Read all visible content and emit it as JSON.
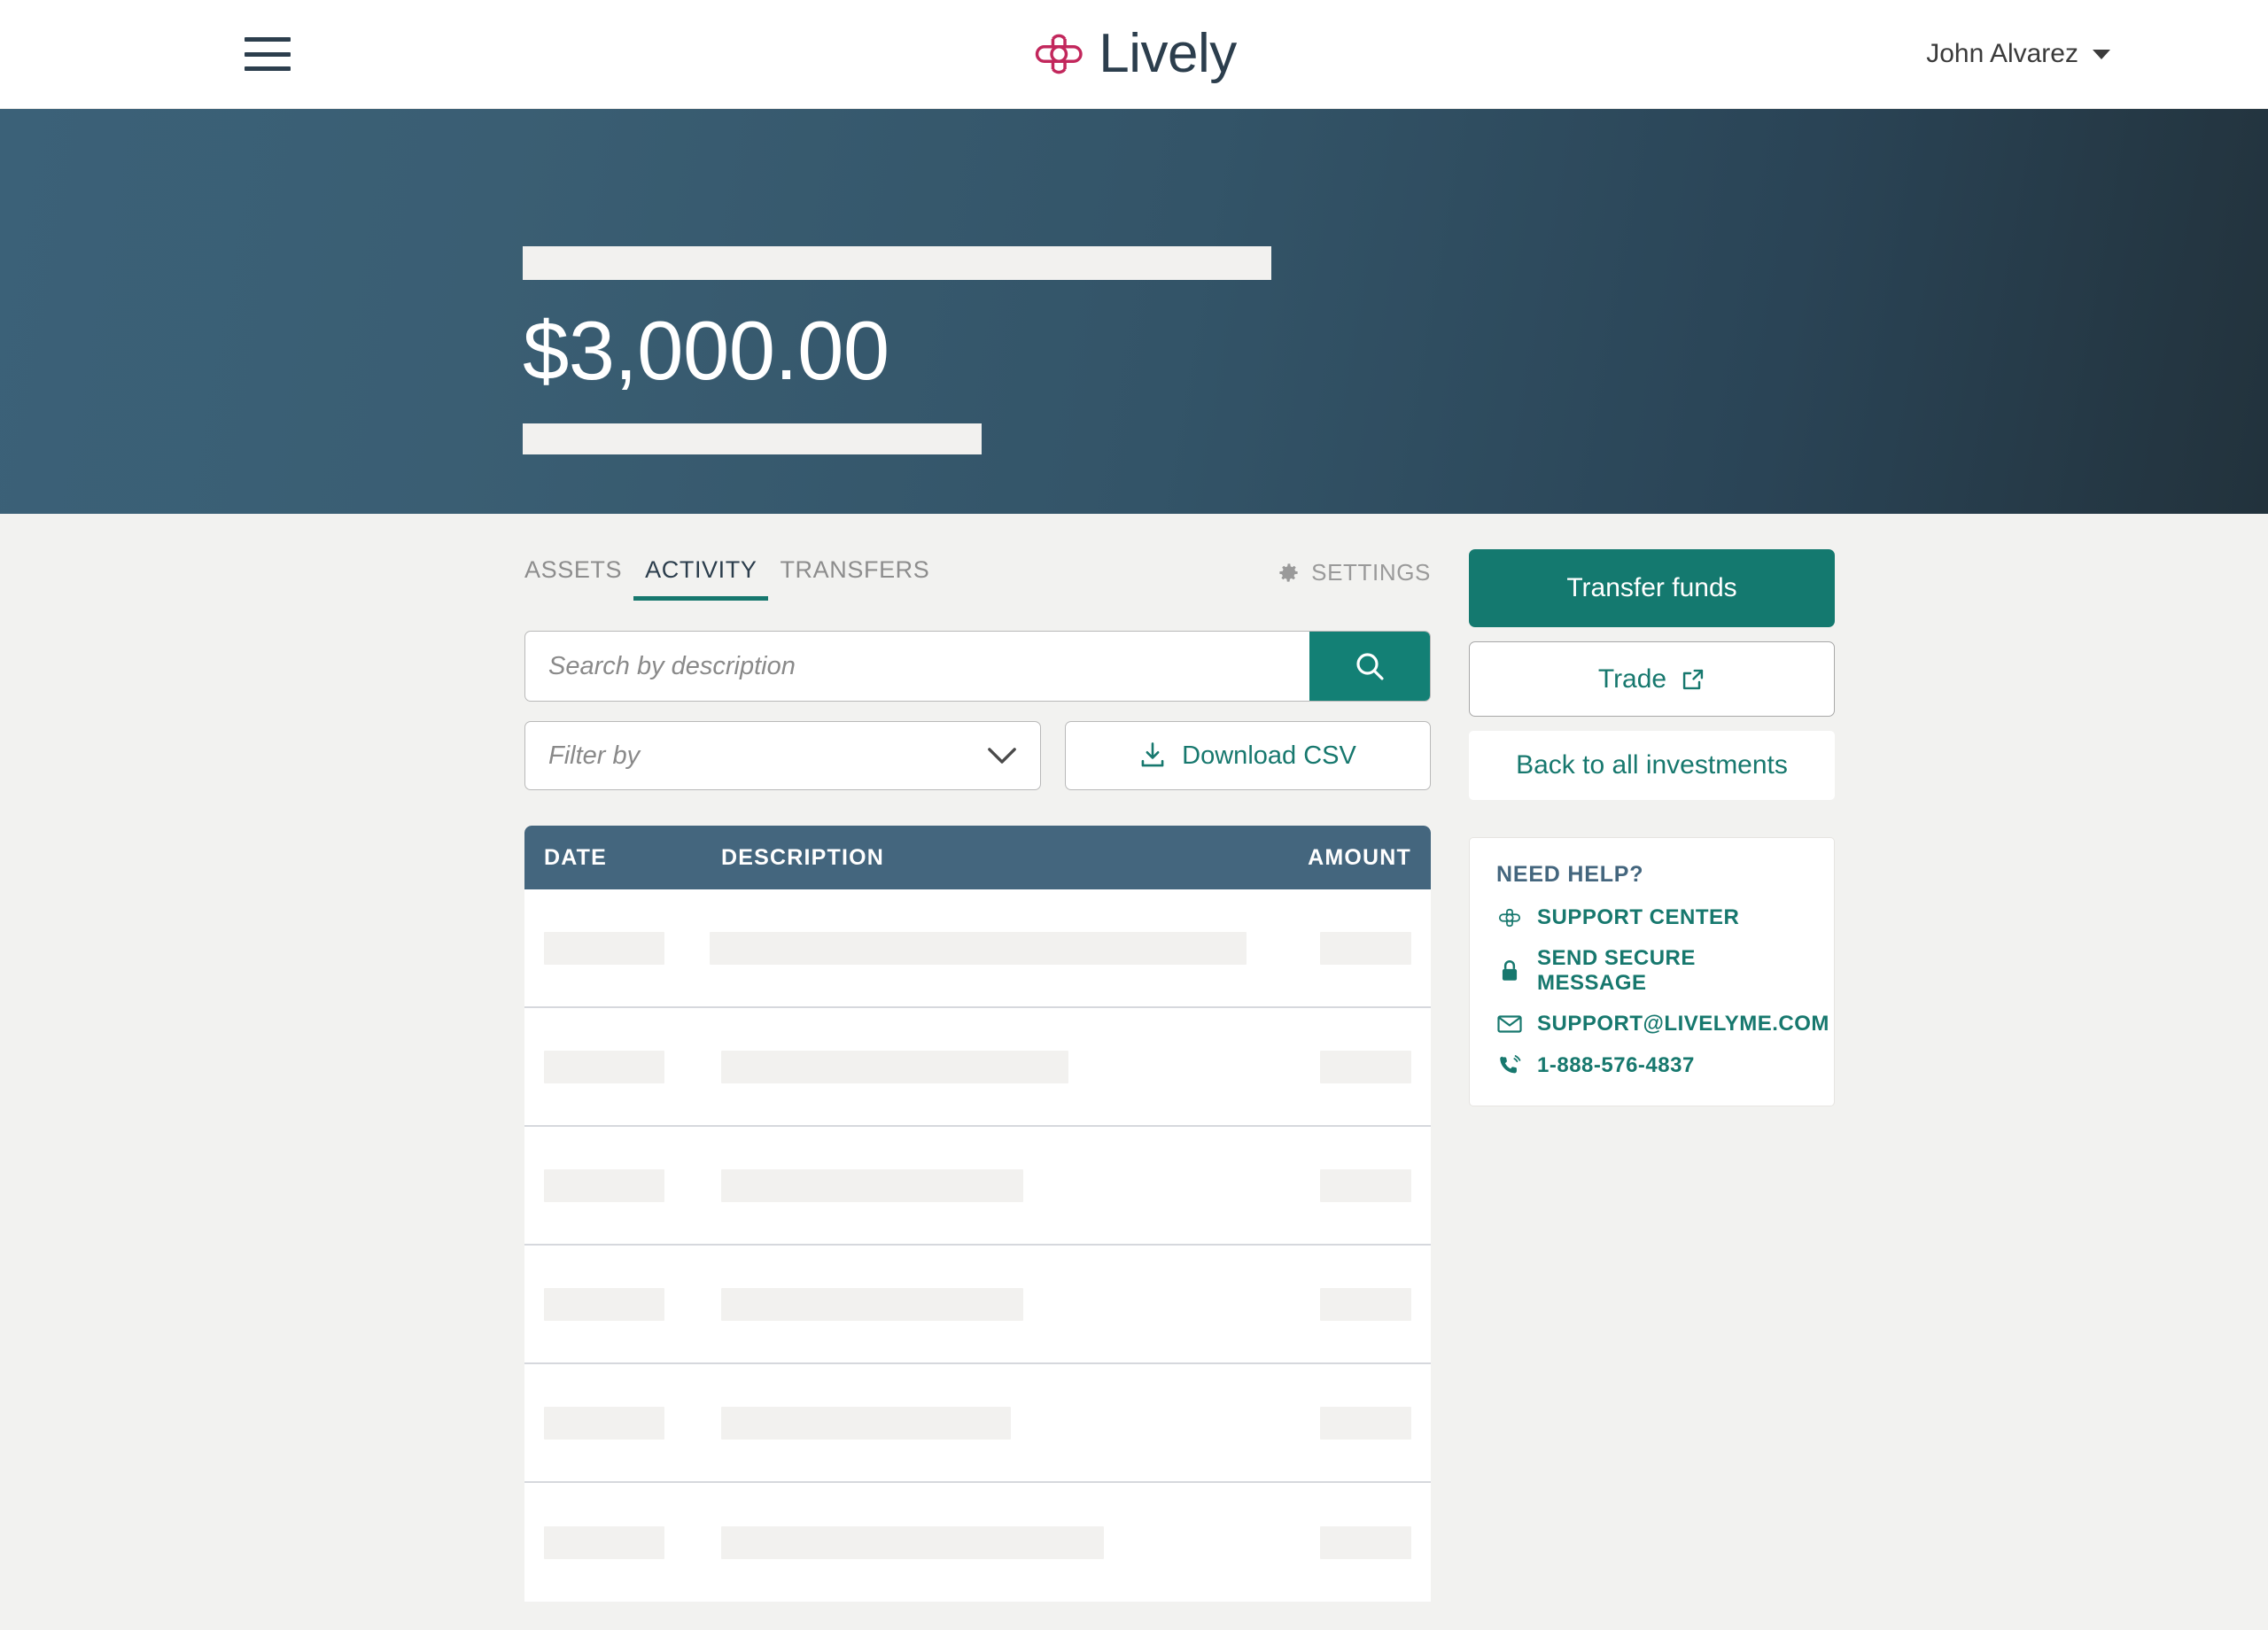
{
  "brand": {
    "name": "Lively",
    "logo_color": "#c2275c",
    "text_color": "#2c3e4d"
  },
  "topnav": {
    "menu_icon": "hamburger-icon",
    "user_name": "John Alvarez",
    "caret_icon": "chevron-down-icon"
  },
  "hero": {
    "amount": "$3,000.00",
    "gradient_from": "#3b6178",
    "gradient_to": "#22323c",
    "skeleton_top": true,
    "skeleton_bottom": true
  },
  "tabs": [
    {
      "label": "ASSETS",
      "active": false
    },
    {
      "label": "ACTIVITY",
      "active": true
    },
    {
      "label": "TRANSFERS",
      "active": false
    }
  ],
  "settings": {
    "label": "SETTINGS",
    "icon": "gear-icon"
  },
  "search": {
    "placeholder": "Search by description",
    "value": "",
    "button_icon": "search-icon",
    "button_color": "#138075"
  },
  "filter": {
    "placeholder": "Filter by",
    "value": "",
    "icon": "chevron-down-icon"
  },
  "download": {
    "label": "Download CSV",
    "icon": "download-icon"
  },
  "table": {
    "columns": [
      "DATE",
      "DESCRIPTION",
      "AMOUNT"
    ],
    "header_bg": "#44667e",
    "loading": true,
    "skeleton_rows": [
      {
        "date_w": 136,
        "desc_w": 606,
        "amt_w": 103
      },
      {
        "date_w": 136,
        "desc_w": 392,
        "amt_w": 103
      },
      {
        "date_w": 136,
        "desc_w": 341,
        "amt_w": 103
      },
      {
        "date_w": 136,
        "desc_w": 341,
        "amt_w": 103
      },
      {
        "date_w": 136,
        "desc_w": 327,
        "amt_w": 103
      },
      {
        "date_w": 136,
        "desc_w": 432,
        "amt_w": 103
      }
    ]
  },
  "actions": {
    "transfer_funds": "Transfer funds",
    "trade": "Trade",
    "trade_icon": "external-link-icon",
    "back": "Back to all investments",
    "primary_color": "#14796f",
    "link_color": "#17786e"
  },
  "help": {
    "title": "NEED HELP?",
    "links": [
      {
        "label": "SUPPORT CENTER",
        "icon": "lively-cross-icon"
      },
      {
        "label": "SEND SECURE MESSAGE",
        "icon": "lock-icon"
      },
      {
        "label": "SUPPORT@LIVELYME.COM",
        "icon": "envelope-icon"
      },
      {
        "label": "1-888-576-4837",
        "icon": "phone-icon"
      }
    ]
  }
}
